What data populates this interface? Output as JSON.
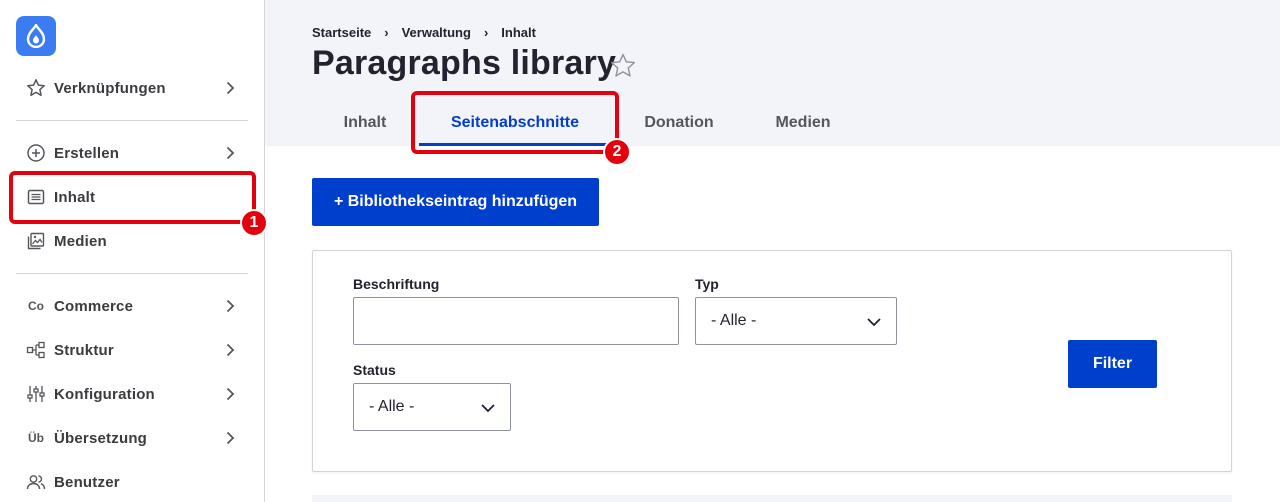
{
  "sidebar": {
    "items": [
      {
        "label": "Verknüpfungen",
        "icon": "star-icon"
      },
      {
        "label": "Erstellen",
        "icon": "plus-circle-icon"
      },
      {
        "label": "Inhalt",
        "icon": "document-list-icon"
      },
      {
        "label": "Medien",
        "icon": "image-icon"
      },
      {
        "label": "Commerce",
        "icon": "commerce-abbrev-icon",
        "abbrev": "Co"
      },
      {
        "label": "Struktur",
        "icon": "structure-icon"
      },
      {
        "label": "Konfiguration",
        "icon": "sliders-icon"
      },
      {
        "label": "Übersetzung",
        "icon": "translation-abbrev-icon",
        "abbrev": "Üb"
      },
      {
        "label": "Benutzer",
        "icon": "users-icon"
      }
    ]
  },
  "breadcrumb": [
    "Startseite",
    "Verwaltung",
    "Inhalt"
  ],
  "page_title": "Paragraphs library",
  "tabs": [
    {
      "label": "Inhalt",
      "active": false
    },
    {
      "label": "Seitenabschnitte",
      "active": true
    },
    {
      "label": "Donation",
      "active": false
    },
    {
      "label": "Medien",
      "active": false
    }
  ],
  "callouts": [
    "1",
    "2"
  ],
  "add_button": "+ Bibliothekseintrag hinzufügen",
  "filters": {
    "label_field": {
      "label": "Beschriftung",
      "value": ""
    },
    "type_field": {
      "label": "Typ",
      "value": "- Alle -"
    },
    "status_field": {
      "label": "Status",
      "value": "- Alle -"
    },
    "submit": "Filter"
  },
  "colors": {
    "accent": "#003ecc",
    "logo": "#3b7cf3",
    "callout": "#e5000e",
    "header_bg": "#f3f4f9"
  }
}
